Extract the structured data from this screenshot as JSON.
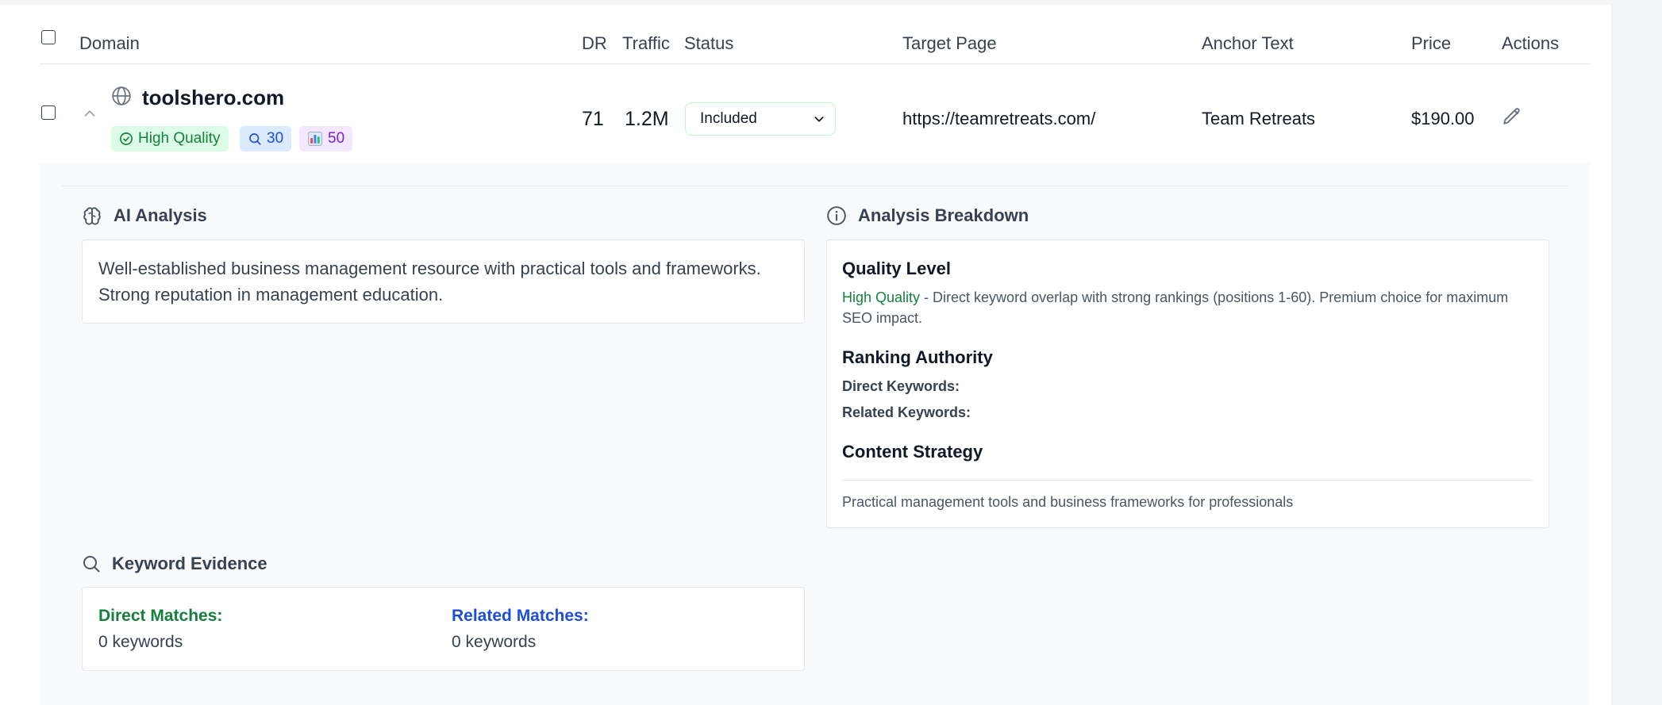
{
  "table": {
    "headers": {
      "domain": "Domain",
      "dr": "DR",
      "traffic": "Traffic",
      "status": "Status",
      "target_page": "Target Page",
      "anchor_text": "Anchor Text",
      "price": "Price",
      "actions": "Actions"
    },
    "row": {
      "domain": "toolshero.com",
      "badges": {
        "quality": "High Quality",
        "keywords": "30",
        "chart": "50"
      },
      "dr": "71",
      "traffic": "1.2M",
      "status": "Included",
      "target_page": "https://teamretreats.com/",
      "anchor_text": "Team Retreats",
      "price": "$190.00"
    }
  },
  "ai_analysis": {
    "title": "AI Analysis",
    "text": "Well-established business management resource with practical tools and frameworks. Strong reputation in management education."
  },
  "breakdown": {
    "title": "Analysis Breakdown",
    "quality_heading": "Quality Level",
    "quality_label": "High Quality",
    "quality_text": " - Direct keyword overlap with strong rankings (positions 1-60). Premium choice for maximum SEO impact.",
    "ranking_heading": "Ranking Authority",
    "direct_keywords_label": "Direct Keywords:",
    "related_keywords_label": "Related Keywords:",
    "content_heading": "Content Strategy",
    "content_text": "Practical management tools and business frameworks for professionals"
  },
  "keyword_evidence": {
    "title": "Keyword Evidence",
    "direct_label": "Direct Matches:",
    "direct_value": "0 keywords",
    "related_label": "Related Matches:",
    "related_value": "0 keywords"
  },
  "colors": {
    "quality_badge_bg": "#dcfce7",
    "quality_badge_fg": "#15803d",
    "keyword_badge_bg": "#dbeafe",
    "keyword_badge_fg": "#1d4ed8",
    "chart_badge_bg": "#f3e8ff",
    "chart_badge_fg": "#7e22ce"
  },
  "icons": {
    "globe": "globe-icon",
    "chevron_up": "chevron-up-icon",
    "check_circle": "check-circle-icon",
    "search": "search-icon",
    "bar_chart": "bar-chart-icon",
    "chevron_down": "chevron-down-icon",
    "pencil": "pencil-icon",
    "brain": "brain-icon",
    "info": "info-icon"
  }
}
